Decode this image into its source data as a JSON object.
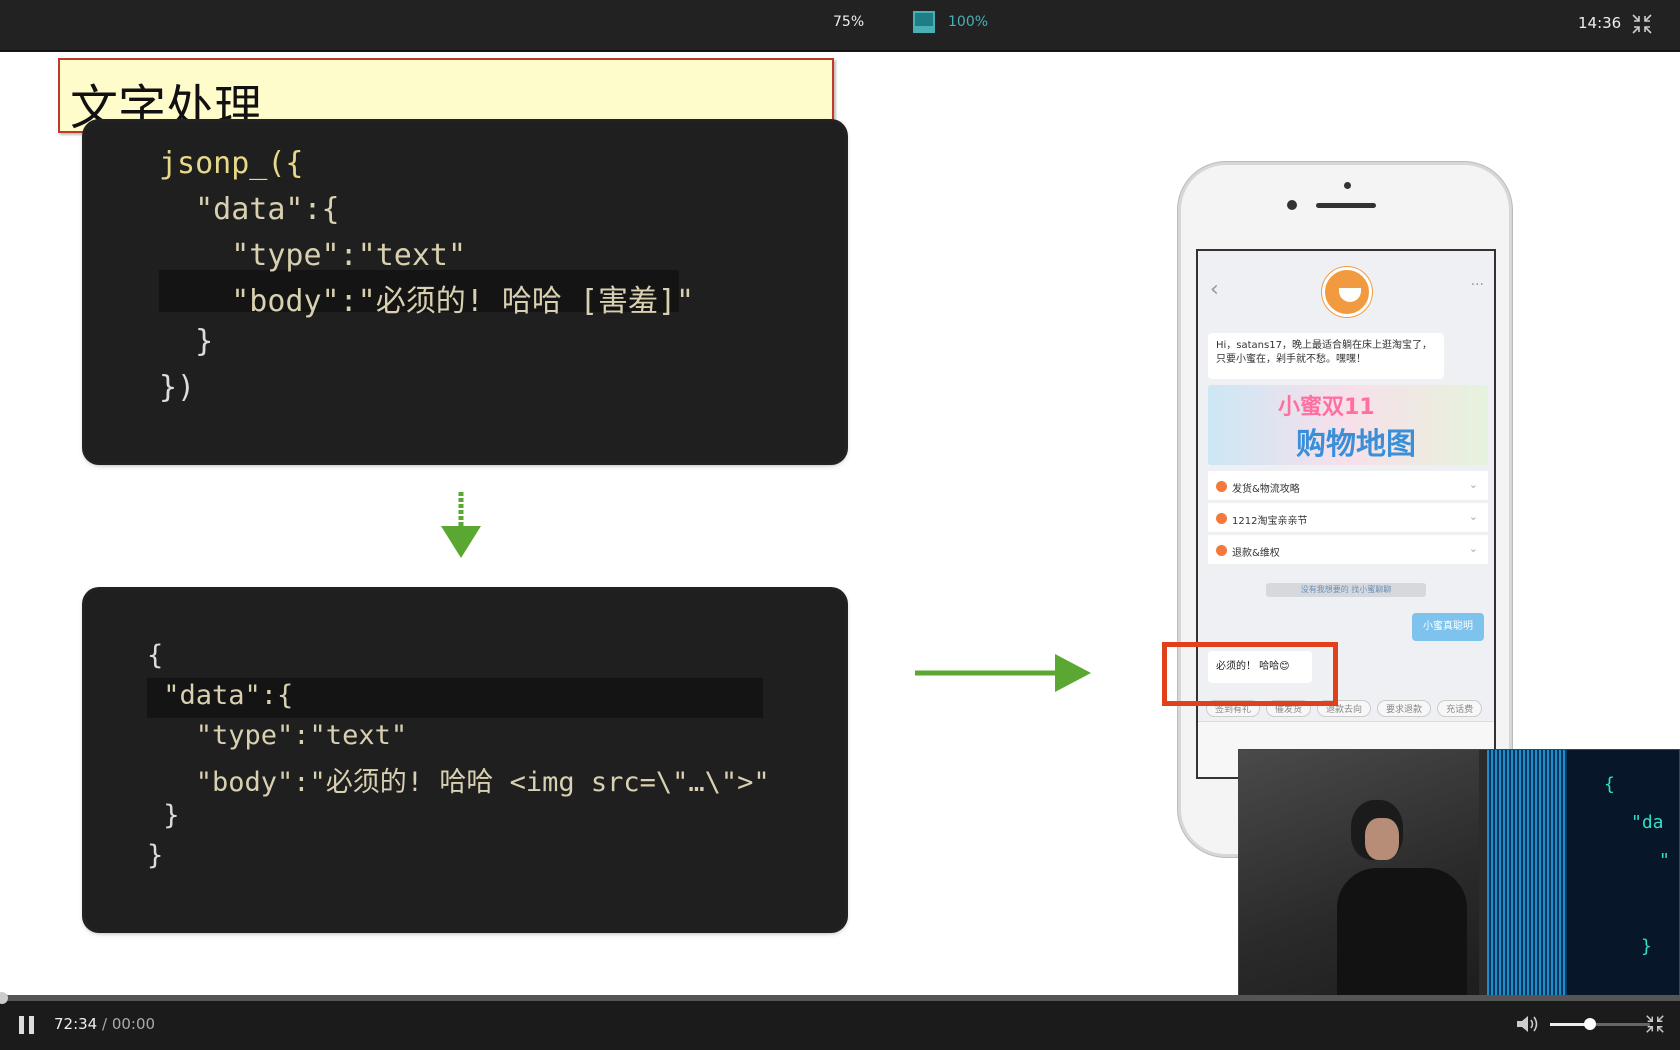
{
  "topbar": {
    "zoom_a": "75%",
    "zoom_b": "100%",
    "clock": "14:36",
    "icons": [
      "screen-icon",
      "exit-fullscreen-icon"
    ]
  },
  "slide": {
    "title": "文字处理",
    "code_before": [
      "jsonp_({",
      "  \"data\":{",
      "    \"type\":\"text\"",
      "    \"body\":\"必须的! 哈哈 [害羞]\"",
      "  }",
      "})"
    ],
    "code_after": [
      "{",
      " \"data\":{",
      "   \"type\":\"text\"",
      "   \"body\":\"必须的! 哈哈 <img src=\\\"…\\\">\"",
      " }",
      "}"
    ],
    "phone": {
      "greeting": "Hi，satans17，晚上最适合躺在床上逛淘宝了，只要小蜜在，剁手就不愁。嘿嘿！",
      "banner_line1": "小蜜双11",
      "banner_line2": "购物地图",
      "menu": [
        "发货&物流攻略",
        "1212淘宝亲亲节",
        "退款&维权"
      ],
      "notice": "没有我想要的 找小蜜聊聊",
      "user_message": "小蜜真聪明",
      "bot_reply": "必须的！ 哈哈😊",
      "quick_replies": [
        "签到有礼",
        "催发货",
        "退款去向",
        "要求退款",
        "充话费"
      ]
    },
    "pip_code": [
      "{",
      "\"da",
      "\"",
      "}"
    ]
  },
  "player": {
    "current_time": "72:34",
    "separator": " / ",
    "duration": "00:00",
    "volume_level": 0.4,
    "progress": 0.0
  }
}
